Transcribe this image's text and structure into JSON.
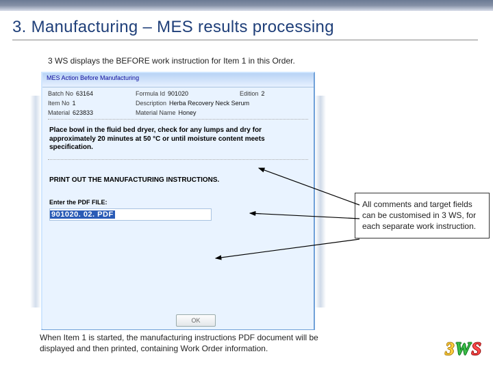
{
  "slide": {
    "title": "3. Manufacturing – MES results processing",
    "caption": "3 WS displays the BEFORE work instruction for Item 1 in this Order.",
    "bottom_note": "When Item 1 is started, the manufacturing instructions PDF document will be displayed and then printed, containing Work Order information."
  },
  "app": {
    "titlebar": "MES Action   Before Manufacturing",
    "fields": {
      "batch_no_label": "Batch No",
      "batch_no": "63164",
      "formula_id_label": "Formula Id",
      "formula_id": "901020",
      "edition_label": "Edition",
      "edition": "2",
      "item_no_label": "Item No",
      "item_no": "1",
      "description_label": "Description",
      "description": "Herba Recovery Neck Serum",
      "material_label": "Material",
      "material": "623833",
      "material_name_label": "Material Name",
      "material_name": "Honey"
    },
    "work_text": "Place bowl in the fluid bed dryer, check for any lumps and dry for approximately 20 minutes at 50 °C or until moisture content meets specification.",
    "print_text": "PRINT OUT THE MANUFACTURING INSTRUCTIONS.",
    "enter_label": "Enter the PDF FILE:",
    "pdf_value": "901020. 02. PDF",
    "ok_label": "OK"
  },
  "annotation": {
    "text": "All comments and target fields can be customised in 3 WS, for each separate work instruction."
  },
  "logo": {
    "c3": "3",
    "cW": "W",
    "cS": "S"
  }
}
